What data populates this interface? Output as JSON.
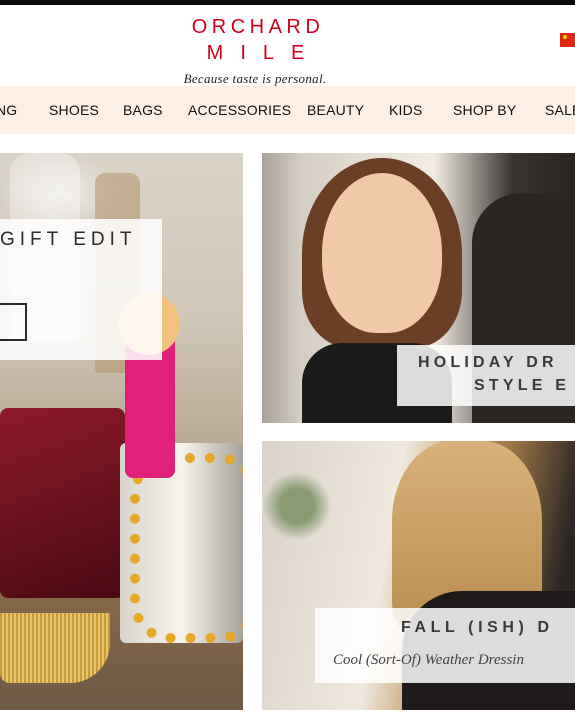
{
  "header": {
    "logo_line1": "ORCHARD",
    "logo_line2": "MILE",
    "tagline": "Because taste is personal.",
    "brand_color": "#d0021b",
    "flag_icon": "china-flag-icon"
  },
  "nav": {
    "background": "#fcefe6",
    "items": [
      "NG",
      "SHOES",
      "BAGS",
      "ACCESSORIES",
      "BEAUTY",
      "KIDS",
      "SHOP BY",
      "SALE"
    ]
  },
  "tiles": {
    "gift": {
      "title": "GIFT EDIT"
    },
    "holiday": {
      "line1": "HOLIDAY DR",
      "line2": "STYLE E"
    },
    "fall": {
      "title": "FALL (ISH) D",
      "subtitle": "Cool (Sort-Of) Weather Dressin"
    }
  }
}
